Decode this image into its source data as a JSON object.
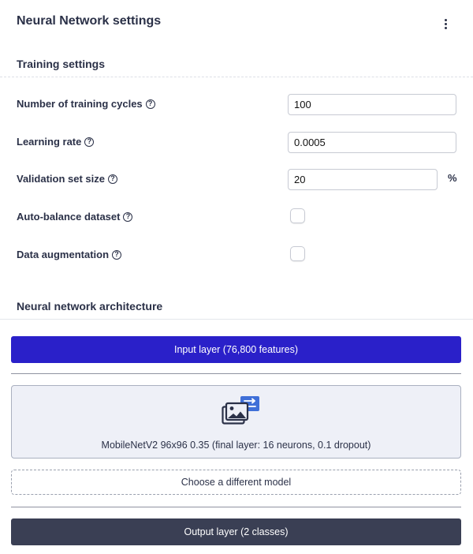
{
  "panel": {
    "title": "Neural Network settings",
    "menu_icon": "kebab-menu-icon"
  },
  "training": {
    "section_title": "Training settings",
    "fields": {
      "training_cycles": {
        "label": "Number of training cycles",
        "value": "100"
      },
      "learning_rate": {
        "label": "Learning rate",
        "value": "0.0005"
      },
      "validation_size": {
        "label": "Validation set size",
        "value": "20",
        "unit": "%"
      },
      "auto_balance": {
        "label": "Auto-balance dataset",
        "checked": false
      },
      "data_augmentation": {
        "label": "Data augmentation",
        "checked": false
      }
    },
    "help_glyph": "?"
  },
  "architecture": {
    "section_title": "Neural network architecture",
    "input_layer": "Input layer (76,800 features)",
    "model": {
      "icon": "transfer-learning-images-icon",
      "description": "MobileNetV2 96x96 0.35 (final layer: 16 neurons, 0.1 dropout)"
    },
    "choose_model": "Choose a different model",
    "output_layer": "Output layer (2 classes)"
  },
  "colors": {
    "input_layer": "#2a20c9",
    "output_layer": "#3a3f54",
    "model_box": "#eef0f7",
    "icon_accent": "#3f6fd8",
    "text": "#2b3148"
  }
}
